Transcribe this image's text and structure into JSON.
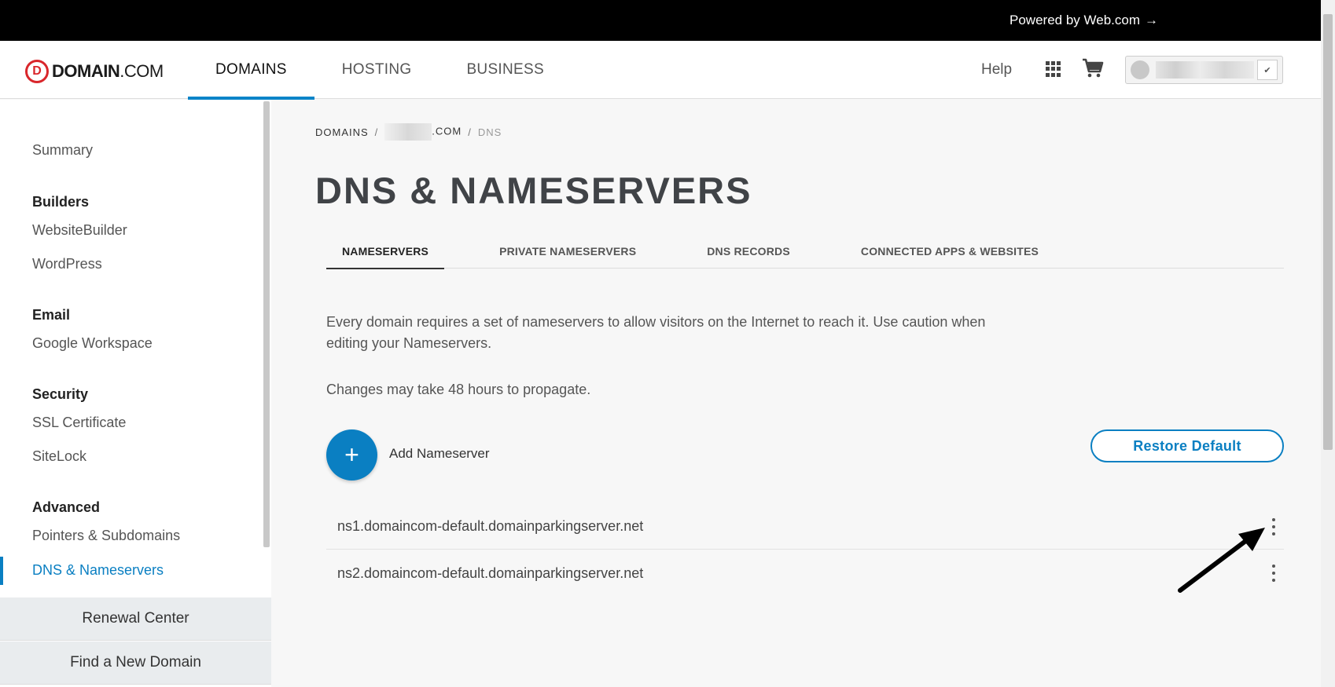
{
  "topbar": {
    "powered_by": "Powered by Web.com",
    "arrow": "→"
  },
  "header": {
    "logo_mark": "D",
    "logo_bold": "DOMAIN",
    "logo_light": ".COM",
    "nav": [
      "DOMAINS",
      "HOSTING",
      "BUSINESS"
    ],
    "help": "Help",
    "account_caret": "✔"
  },
  "sidebar": {
    "summary": "Summary",
    "builders_head": "Builders",
    "website_builder": "WebsiteBuilder",
    "wordpress": "WordPress",
    "email_head": "Email",
    "google_workspace": "Google Workspace",
    "security_head": "Security",
    "ssl": "SSL Certificate",
    "sitelock": "SiteLock",
    "advanced_head": "Advanced",
    "pointers": "Pointers & Subdomains",
    "dns": "DNS & Nameservers",
    "renewal": "Renewal Center",
    "find_domain": "Find a New Domain"
  },
  "breadcrumb": {
    "domains": "DOMAINS",
    "sep": "/",
    "domain_suffix": ".COM",
    "current": "DNS"
  },
  "page": {
    "title": "DNS & NAMESERVERS",
    "tabs": [
      "NAMESERVERS",
      "PRIVATE NAMESERVERS",
      "DNS RECORDS",
      "CONNECTED APPS & WEBSITES"
    ],
    "description": "Every domain requires a set of nameservers to allow visitors on the Internet to reach it. Use caution when editing your Nameservers.",
    "note": "Changes may take 48 hours to propagate.",
    "add_icon": "+",
    "add_label": "Add Nameserver",
    "restore_label": "Restore Default",
    "nameservers": [
      "ns1.domaincom-default.domainparkingserver.net",
      "ns2.domaincom-default.domainparkingserver.net"
    ]
  }
}
